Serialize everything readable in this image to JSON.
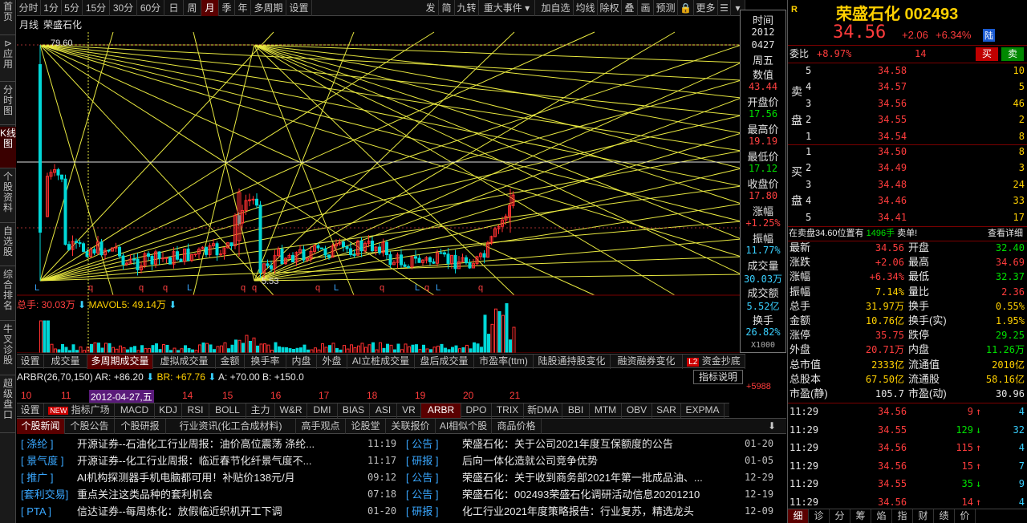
{
  "sidebar": {
    "items": [
      "首页",
      "应用",
      "分时图",
      "K线图",
      "个股资料",
      "自选股",
      "综合排名",
      "牛叉诊股",
      "超级盘口"
    ]
  },
  "toolbar": {
    "left": [
      "分时",
      "1分",
      "5分",
      "15分",
      "30分",
      "60分",
      "日",
      "周",
      "月",
      "季",
      "年",
      "多周期",
      "设置"
    ],
    "right": [
      "发",
      "简",
      "九转",
      "重大事件",
      "加自选",
      "均线",
      "除权",
      "叠",
      "画",
      "预测",
      "更多"
    ]
  },
  "chart": {
    "period_label": "月线",
    "stock_name": "荣盛石化",
    "high_label": "79.60",
    "low_label": "5.53",
    "markers": [
      "L",
      "q",
      "q",
      "q",
      "L",
      "q",
      "q",
      "q",
      "L",
      "q",
      "L",
      "q",
      "L",
      "q",
      "L",
      "L",
      "q"
    ]
  },
  "tooltip": {
    "time_label": "时间",
    "year": "2012",
    "date": "0427",
    "weekday": "周五",
    "value_label": "数值",
    "value": "43.44",
    "open_label": "开盘价",
    "open": "17.56",
    "high_label": "最高价",
    "high": "19.19",
    "low_label": "最低价",
    "low": "17.12",
    "close_label": "收盘价",
    "close": "17.80",
    "chg_label": "涨幅",
    "chg": "+1.25%",
    "amp_label": "振幅",
    "amp": "11.77%",
    "vol_label": "成交量",
    "vol": "30.03万",
    "amt_label": "成交额",
    "amt": "5.52亿",
    "turn_label": "换手",
    "turn": "26.82%",
    "unit": "X1000"
  },
  "volume": {
    "total": "总手: 30.03万",
    "mavol": "MAVOL5: 49.14万"
  },
  "ind_tabs": [
    "设置",
    "成交量",
    "多周期成交量",
    "虚拟成交量",
    "金额",
    "换手率",
    "内盘",
    "外盘",
    "AI立桩成交量",
    "盘后成交量",
    "市盈率(ttm)",
    "陆股通持股变化",
    "融资融券变化",
    "资金抄底"
  ],
  "arbr": {
    "name": "ARBR(26,70,150)",
    "ar": "AR: +86.20",
    "br": "BR: +67.76",
    "a": "A: +70.00",
    "b": "B: +150.0",
    "help": "指标说明",
    "right_val": "+5988"
  },
  "xaxis": {
    "labels": [
      "10",
      "11",
      "2012-04-27,五",
      "14",
      "15",
      "16",
      "17",
      "18",
      "19",
      "20",
      "21"
    ]
  },
  "ind_tabs2": [
    "设置",
    "指标广场",
    "MACD",
    "KDJ",
    "RSI",
    "BOLL",
    "主力",
    "W&R",
    "DMI",
    "BIAS",
    "ASI",
    "VR",
    "ARBR",
    "DPO",
    "TRIX",
    "新DMA",
    "BBI",
    "MTM",
    "OBV",
    "SAR",
    "EXPMA"
  ],
  "new_badge": "NEW",
  "news_tabs": [
    "个股新闻",
    "个股公告",
    "个股研报",
    "行业资讯(化工合成材料)",
    "高手观点",
    "论股堂",
    "关联报价",
    "AI相似个股",
    "商品价格"
  ],
  "news_left": [
    {
      "cat": "[ 涤纶 ]",
      "title": "开源证券--石油化工行业周报：油价高位震荡 涤纶...",
      "time": "11:19"
    },
    {
      "cat": "[ 景气度 ]",
      "title": "开源证券--化工行业周报：临近春节化纤景气度不...",
      "time": "11:17"
    },
    {
      "cat": "[ 推广 ]",
      "title": "AI机构探测器手机电脑都可用！补贴价138元/月",
      "time": "09:12"
    },
    {
      "cat": "[套利交易]",
      "title": "重点关注这类品种的套利机会",
      "time": "07:18"
    },
    {
      "cat": "[ PTA ]",
      "title": "信达证券--每周炼化：放假临近织机开工下调",
      "time": "01-20"
    }
  ],
  "news_right": [
    {
      "cat": "[ 公告 ]",
      "title": "荣盛石化：关于公司2021年度互保额度的公告",
      "time": "01-20"
    },
    {
      "cat": "[ 研报 ]",
      "title": "后向一体化造就公司竞争优势",
      "time": "01-05"
    },
    {
      "cat": "[ 公告 ]",
      "title": "荣盛石化：关于收到商务部2021年第一批成品油、...",
      "time": "12-29"
    },
    {
      "cat": "[ 公告 ]",
      "title": "荣盛石化：002493荣盛石化调研活动信息20201210",
      "time": "12-19"
    },
    {
      "cat": "[ 研报 ]",
      "title": "化工行业2021年度策略报告：行业复苏，精选龙头",
      "time": "12-09"
    }
  ],
  "quote": {
    "r_badge": "R",
    "name": "荣盛石化 002493",
    "price": "34.56",
    "change": "+2.06",
    "pct": "+6.34%",
    "lu": "陆",
    "wb_label": "委比",
    "wb": "+8.97%",
    "wc": "14",
    "buy": "买",
    "sell": "卖",
    "sell_label": "卖盘",
    "buy_label": "买盘",
    "asks": [
      {
        "lv": "5",
        "p": "34.58",
        "v": "10"
      },
      {
        "lv": "4",
        "p": "34.57",
        "v": "5"
      },
      {
        "lv": "3",
        "p": "34.56",
        "v": "46"
      },
      {
        "lv": "2",
        "p": "34.55",
        "v": "2"
      },
      {
        "lv": "1",
        "p": "34.54",
        "v": "8"
      }
    ],
    "bids": [
      {
        "lv": "1",
        "p": "34.50",
        "v": "8"
      },
      {
        "lv": "2",
        "p": "34.49",
        "v": "3"
      },
      {
        "lv": "3",
        "p": "34.48",
        "v": "24"
      },
      {
        "lv": "4",
        "p": "34.46",
        "v": "33"
      },
      {
        "lv": "5",
        "p": "34.41",
        "v": "17"
      }
    ],
    "notice_a": "在卖盘34.60位置有",
    "notice_b": "1496手",
    "notice_c": "卖单!",
    "notice_link": "查看详细",
    "stats": [
      {
        "l1": "最新",
        "v1": "34.56",
        "c1": "red",
        "l2": "开盘",
        "v2": "32.40",
        "c2": "green"
      },
      {
        "l1": "涨跌",
        "v1": "+2.06",
        "c1": "red",
        "l2": "最高",
        "v2": "34.69",
        "c2": "red"
      },
      {
        "l1": "涨幅",
        "v1": "+6.34%",
        "c1": "red",
        "l2": "最低",
        "v2": "32.37",
        "c2": "green"
      },
      {
        "l1": "振幅",
        "v1": "7.14%",
        "c1": "yellow",
        "l2": "量比",
        "v2": "2.36",
        "c2": "red"
      },
      {
        "l1": "总手",
        "v1": "31.97万",
        "c1": "yellow",
        "l2": "换手",
        "v2": "0.55%",
        "c2": "yellow"
      },
      {
        "l1": "金额",
        "v1": "10.76亿",
        "c1": "yellow",
        "l2": "换手(实)",
        "v2": "1.95%",
        "c2": "yellow"
      },
      {
        "l1": "涨停",
        "v1": "35.75",
        "c1": "red",
        "l2": "跌停",
        "v2": "29.25",
        "c2": "green"
      },
      {
        "l1": "外盘",
        "v1": "20.71万",
        "c1": "red",
        "l2": "内盘",
        "v2": "11.26万",
        "c2": "green"
      },
      {
        "l1": "总市值",
        "v1": "2333亿",
        "c1": "yellow",
        "l2": "流通值",
        "v2": "2010亿",
        "c2": "yellow"
      },
      {
        "l1": "总股本",
        "v1": "67.50亿",
        "c1": "yellow",
        "l2": "流通股",
        "v2": "58.16亿",
        "c2": "yellow"
      },
      {
        "l1": "市盈(静)",
        "v1": "105.7",
        "c1": "white",
        "l2": "市盈(动)",
        "v2": "30.96",
        "c2": "white"
      }
    ],
    "ticks": [
      {
        "t": "11:29",
        "p": "34.56",
        "v": "9",
        "dir": "up",
        "n": "4"
      },
      {
        "t": "11:29",
        "p": "34.55",
        "v": "129",
        "dir": "down",
        "n": "32"
      },
      {
        "t": "11:29",
        "p": "34.56",
        "v": "115",
        "dir": "up",
        "n": "4"
      },
      {
        "t": "11:29",
        "p": "34.56",
        "v": "15",
        "dir": "up",
        "n": "7"
      },
      {
        "t": "11:29",
        "p": "34.55",
        "v": "35",
        "dir": "down",
        "n": "9"
      },
      {
        "t": "11:29",
        "p": "34.56",
        "v": "14",
        "dir": "up",
        "n": "4"
      }
    ],
    "bottom_tabs": [
      "细",
      "诊",
      "分",
      "筹",
      "焰",
      "指",
      "财",
      "绩",
      "价"
    ]
  }
}
